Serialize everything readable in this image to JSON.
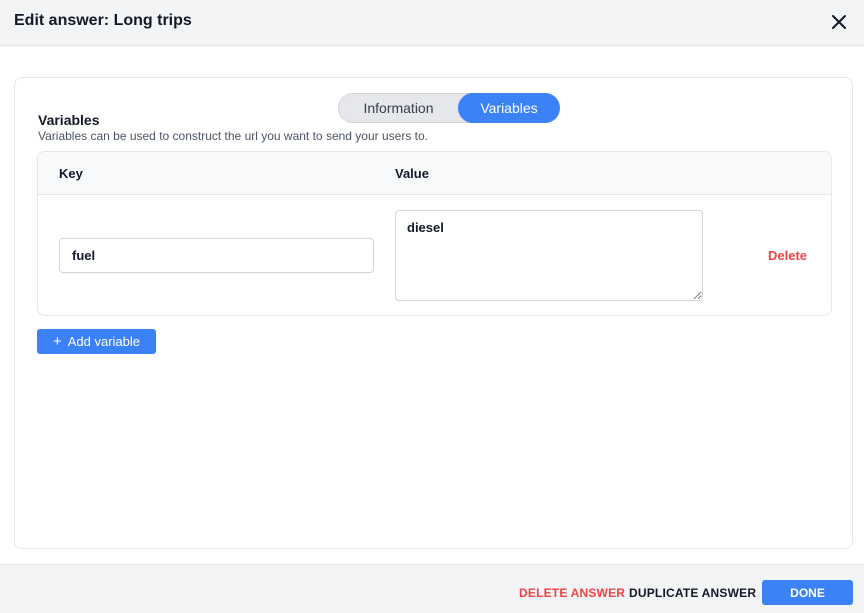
{
  "header": {
    "title": "Edit answer: Long trips",
    "close_icon": "close-icon"
  },
  "tabs": [
    {
      "label": "Information",
      "active": false
    },
    {
      "label": "Variables",
      "active": true
    }
  ],
  "variables_section": {
    "title": "Variables",
    "description": "Variables can be used to construct the url you want to send your users to.",
    "table": {
      "columns": [
        "Key",
        "Value"
      ],
      "rows": [
        {
          "key": "fuel",
          "value": "diesel",
          "delete_label": "Delete"
        }
      ]
    },
    "add_button": {
      "icon": "+",
      "label": "Add variable"
    }
  },
  "footer": {
    "delete_answer": "DELETE ANSWER",
    "duplicate_answer": "DUPLICATE ANSWER",
    "done": "DONE"
  },
  "colors": {
    "accent": "#3b82f6",
    "danger": "#ef4444"
  }
}
